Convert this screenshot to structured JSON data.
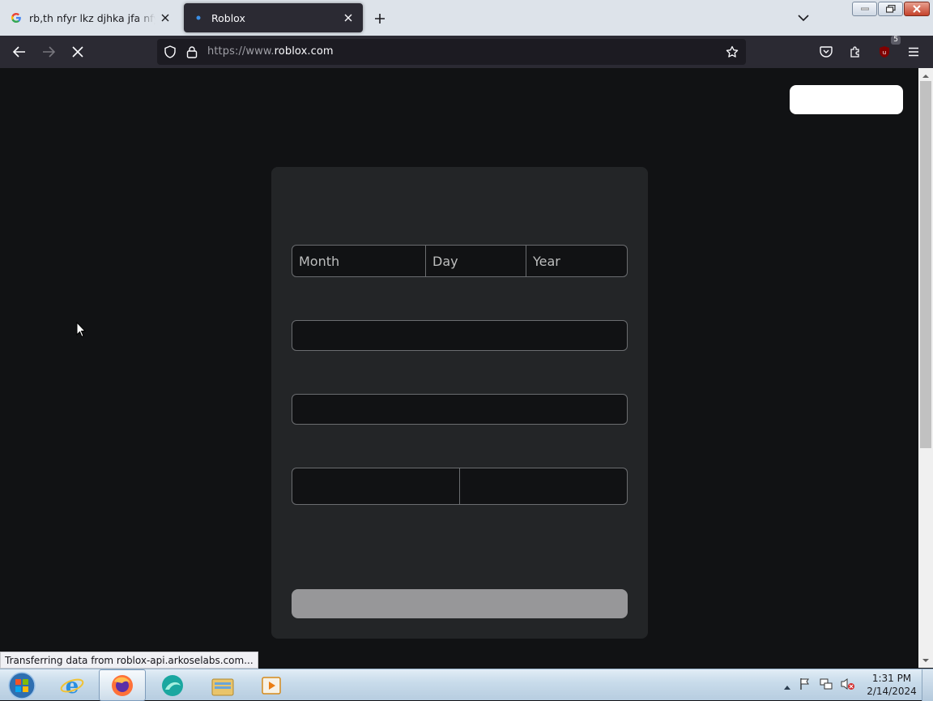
{
  "browser": {
    "tabs": [
      {
        "title": "rb,th nfyr lkz djhka jfa nfyrc - Go",
        "favicon": "google-icon"
      },
      {
        "title": "Roblox",
        "favicon": "loading-dot-icon"
      }
    ],
    "url_prefix": "https://www.",
    "url_domain": "roblox.com",
    "extension_badge": "5",
    "status_text": "Transferring data from roblox-api.arkoselabs.com..."
  },
  "signup": {
    "month_label": "Month",
    "day_label": "Day",
    "year_label": "Year"
  },
  "taskbar": {
    "time": "1:31 PM",
    "date": "2/14/2024",
    "apps": [
      "start-orb",
      "internet-explorer",
      "firefox",
      "browser-app",
      "file-explorer",
      "media-player"
    ]
  }
}
